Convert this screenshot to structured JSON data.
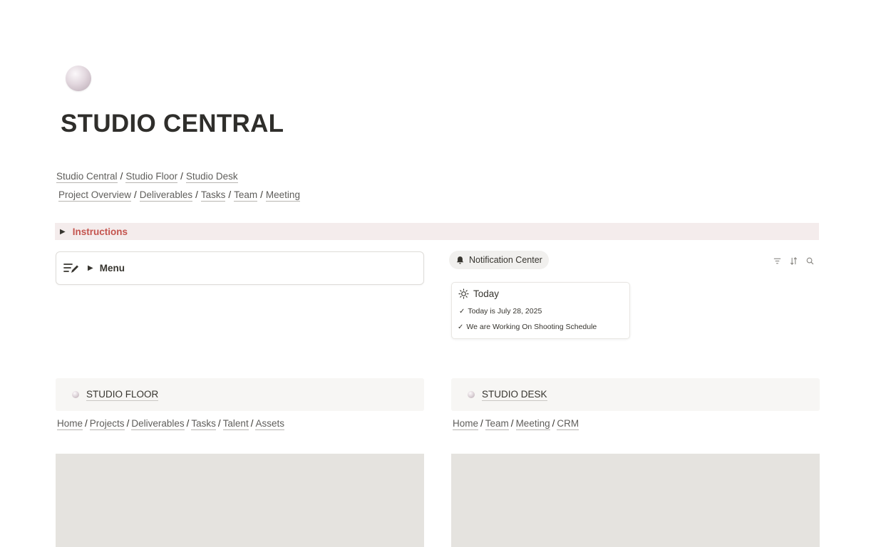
{
  "page": {
    "title": "STUDIO CENTRAL",
    "icon": "sphere-icon"
  },
  "nav_primary": [
    {
      "label": "Studio Central"
    },
    {
      "label": "Studio Floor"
    },
    {
      "label": "Studio Desk"
    }
  ],
  "nav_secondary": [
    {
      "label": "Project Overview"
    },
    {
      "label": "Deliverables"
    },
    {
      "label": "Tasks"
    },
    {
      "label": "Team"
    },
    {
      "label": "Meeting"
    }
  ],
  "separator": "/",
  "instructions_toggle": {
    "label": "Instructions",
    "accent_color": "#c4544e",
    "background": "#f4ecec"
  },
  "menu_toggle": {
    "label": "Menu",
    "icon": "edit-list-icon"
  },
  "notification_center": {
    "tab_label": "Notification Center",
    "tab_icon": "bell-icon",
    "tools": [
      "filter-icon",
      "sort-icon",
      "search-icon"
    ],
    "card": {
      "title": "Today",
      "icon": "sun-icon",
      "items": [
        {
          "check": "✓",
          "text": "Today is July 28, 2025"
        },
        {
          "check": "✓",
          "text": "We are Working On Shooting Schedule"
        }
      ]
    }
  },
  "studio_floor": {
    "title": "STUDIO FLOOR",
    "links": [
      {
        "label": "Home"
      },
      {
        "label": "Projects"
      },
      {
        "label": "Deliverables"
      },
      {
        "label": "Tasks"
      },
      {
        "label": "Talent"
      },
      {
        "label": "Assets"
      }
    ]
  },
  "studio_desk": {
    "title": "STUDIO DESK",
    "links": [
      {
        "label": "Home"
      },
      {
        "label": "Team"
      },
      {
        "label": "Meeting"
      },
      {
        "label": "CRM"
      }
    ]
  },
  "colors": {
    "text": "#37352f",
    "link": "#5f5e5b",
    "section_bg": "#f7f6f4",
    "image_placeholder": "#e5e3df"
  }
}
